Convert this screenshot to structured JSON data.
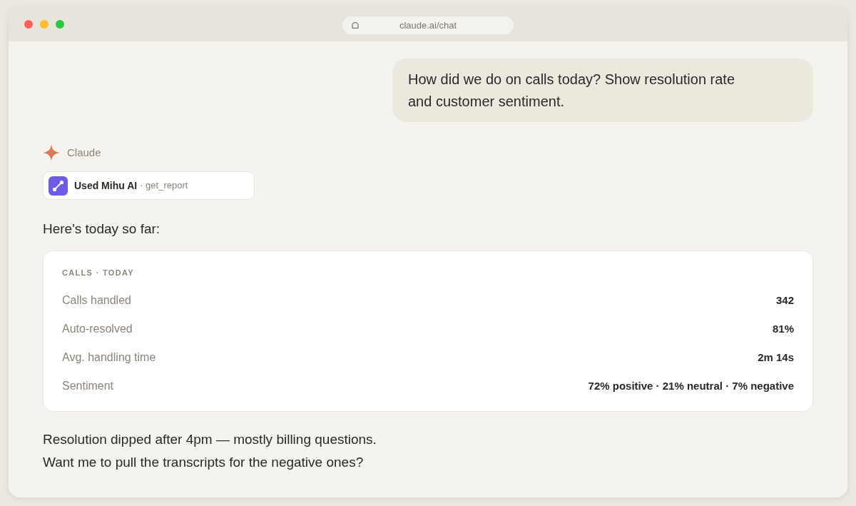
{
  "browser": {
    "url": "claude.ai/chat"
  },
  "user_message": "How did we do on calls today? Show resolution rate and customer sentiment.",
  "assistant": {
    "name": "Claude",
    "tool_call": {
      "label": "Used Mihu AI",
      "detail": "· get_report"
    },
    "intro": "Here's today so far:"
  },
  "card": {
    "title": "CALLS · TODAY",
    "rows": [
      {
        "label": "Calls handled",
        "value": "342"
      },
      {
        "label": "Auto-resolved",
        "value": "81%"
      },
      {
        "label": "Avg. handling time",
        "value": "2m 14s"
      },
      {
        "label": "Sentiment",
        "value": "72% positive · 21% neutral · 7% negative"
      }
    ]
  },
  "closing": [
    "Resolution dipped after 4pm — mostly billing questions.",
    "Want me to pull the transcripts for the negative ones?"
  ]
}
